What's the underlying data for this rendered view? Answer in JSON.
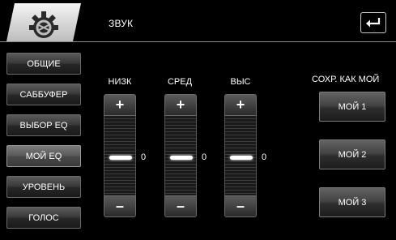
{
  "header": {
    "title": "ЗВУК",
    "logo_icon": "gear-icon",
    "back_icon": "return-arrow-icon"
  },
  "sidebar": {
    "items": [
      {
        "label": "ОБЩИЕ",
        "active": false
      },
      {
        "label": "САББУФЕР",
        "active": false
      },
      {
        "label": "ВЫБОР EQ",
        "active": false
      },
      {
        "label": "МОЙ EQ",
        "active": true
      },
      {
        "label": "УРОВЕНЬ",
        "active": false
      },
      {
        "label": "ГОЛОС",
        "active": false
      }
    ]
  },
  "eq": {
    "bands": [
      {
        "label": "НИЗК",
        "value": "0",
        "plus": "+",
        "minus": "–"
      },
      {
        "label": "СРЕД",
        "value": "0",
        "plus": "+",
        "minus": "–"
      },
      {
        "label": "ВЫС",
        "value": "0",
        "plus": "+",
        "minus": "–"
      }
    ],
    "level_range": {
      "min": -6,
      "max": 6
    }
  },
  "save": {
    "label": "СОХР. КАК МОЙ",
    "buttons": [
      "МОЙ 1",
      "МОЙ 2",
      "МОЙ 3"
    ]
  }
}
